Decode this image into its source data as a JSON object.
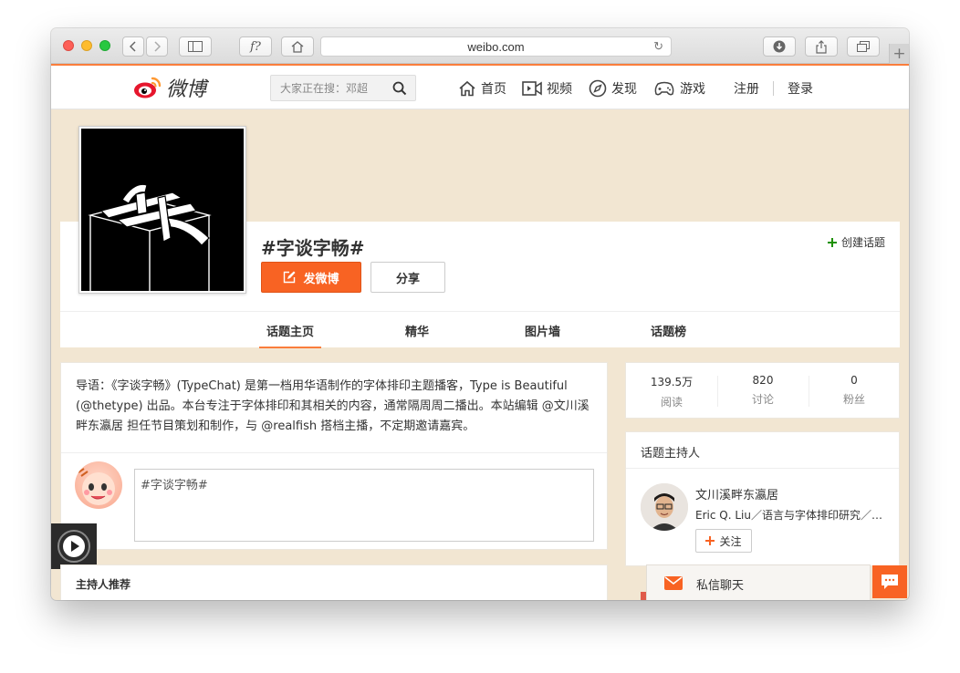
{
  "browser": {
    "url": "weibo.com"
  },
  "nav": {
    "logo_text": "微博",
    "search_placeholder": "大家正在搜：邓超",
    "items": [
      {
        "label": "首页",
        "icon": "home-icon"
      },
      {
        "label": "视频",
        "icon": "video-icon"
      },
      {
        "label": "发现",
        "icon": "compass-icon"
      },
      {
        "label": "游戏",
        "icon": "gamepad-icon"
      }
    ],
    "register": "注册",
    "login": "登录"
  },
  "topic": {
    "title": "#字谈字畅#",
    "create_topic": "创建话题",
    "post_button": "发微博",
    "share_button": "分享",
    "tabs": [
      "话题主页",
      "精华",
      "图片墙",
      "话题榜"
    ],
    "active_tab": 0
  },
  "intro": {
    "text": "导语：《字谈字畅》(TypeChat) 是第一档用华语制作的字体排印主题播客，Type is Beautiful (@thetype) 出品。本台专注于字体排印和其相关的内容，通常隔周周二播出。本站编辑 @文川溪畔东瀛居 担任节目策划和制作，与 @realfish 搭档主播，不定期邀请嘉宾。",
    "composer_value": "#字谈字畅#"
  },
  "stats": [
    {
      "value": "139.5万",
      "label": "阅读"
    },
    {
      "value": "820",
      "label": "讨论"
    },
    {
      "value": "0",
      "label": "粉丝"
    }
  ],
  "host": {
    "section_title": "话题主持人",
    "name": "文川溪畔东瀛居",
    "bio": "Eric Q. Liu／语言与字体排印研究／…",
    "follow": "关注"
  },
  "recommend": {
    "title": "主持人推荐"
  },
  "chat": {
    "label": "私信聊天"
  },
  "colors": {
    "accent": "#f86323",
    "background": "#f2e6d2"
  }
}
